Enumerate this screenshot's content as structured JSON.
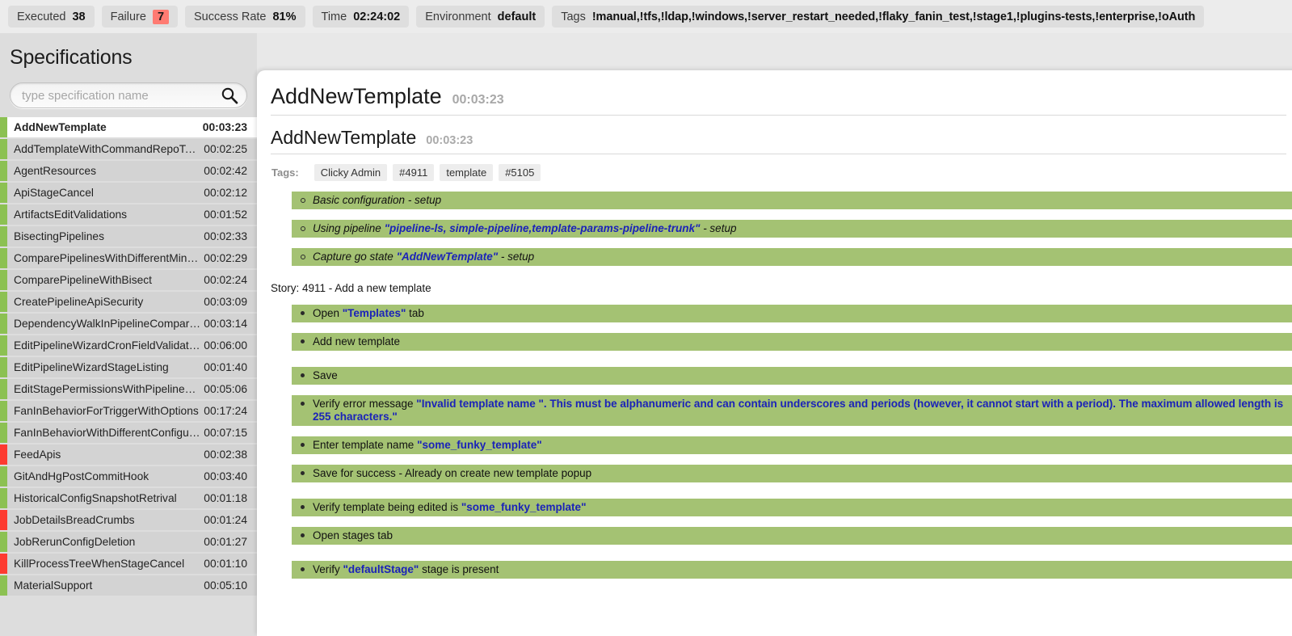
{
  "topbar": {
    "stats": [
      {
        "name": "executed",
        "label": "Executed",
        "value": "38",
        "fail": false
      },
      {
        "name": "failure",
        "label": "Failure",
        "value": "7",
        "fail": true
      },
      {
        "name": "success-rate",
        "label": "Success Rate",
        "value": "81%",
        "fail": false
      },
      {
        "name": "time",
        "label": "Time",
        "value": "02:24:02",
        "fail": false
      },
      {
        "name": "environment",
        "label": "Environment",
        "value": "default",
        "fail": false
      },
      {
        "name": "tags",
        "label": "Tags",
        "value": "!manual,!tfs,!ldap,!windows,!server_restart_needed,!flaky_fanin_test,!stage1,!plugins-tests,!enterprise,!oAuth",
        "fail": false
      }
    ]
  },
  "sidebar": {
    "title": "Specifications",
    "search_placeholder": "type specification name",
    "search_value": "",
    "items": [
      {
        "name": "AddNewTemplate",
        "time": "00:03:23",
        "status": "pass",
        "selected": true
      },
      {
        "name": "AddTemplateWithCommandRepoTask",
        "time": "00:02:25",
        "status": "pass",
        "selected": false
      },
      {
        "name": "AgentResources",
        "time": "00:02:42",
        "status": "pass",
        "selected": false
      },
      {
        "name": "ApiStageCancel",
        "time": "00:02:12",
        "status": "pass",
        "selected": false
      },
      {
        "name": "ArtifactsEditValidations",
        "time": "00:01:52",
        "status": "pass",
        "selected": false
      },
      {
        "name": "BisectingPipelines",
        "time": "00:02:33",
        "status": "pass",
        "selected": false
      },
      {
        "name": "ComparePipelinesWithDifferentMing…",
        "time": "00:02:29",
        "status": "pass",
        "selected": false
      },
      {
        "name": "ComparePipelineWithBisect",
        "time": "00:02:24",
        "status": "pass",
        "selected": false
      },
      {
        "name": "CreatePipelineApiSecurity",
        "time": "00:03:09",
        "status": "pass",
        "selected": false
      },
      {
        "name": "DependencyWalkInPipelineCompar…",
        "time": "00:03:14",
        "status": "pass",
        "selected": false
      },
      {
        "name": "EditPipelineWizardCronFieldValidati…",
        "time": "00:06:00",
        "status": "pass",
        "selected": false
      },
      {
        "name": "EditPipelineWizardStageListing",
        "time": "00:01:40",
        "status": "pass",
        "selected": false
      },
      {
        "name": "EditStagePermissionsWithPipelineG…",
        "time": "00:05:06",
        "status": "pass",
        "selected": false
      },
      {
        "name": "FanInBehaviorForTriggerWithOptions",
        "time": "00:17:24",
        "status": "pass",
        "selected": false
      },
      {
        "name": "FanInBehaviorWithDifferentConfigur…",
        "time": "00:07:15",
        "status": "pass",
        "selected": false
      },
      {
        "name": "FeedApis",
        "time": "00:02:38",
        "status": "fail",
        "selected": false
      },
      {
        "name": "GitAndHgPostCommitHook",
        "time": "00:03:40",
        "status": "pass",
        "selected": false
      },
      {
        "name": "HistoricalConfigSnapshotRetrival",
        "time": "00:01:18",
        "status": "pass",
        "selected": false
      },
      {
        "name": "JobDetailsBreadCrumbs",
        "time": "00:01:24",
        "status": "fail",
        "selected": false
      },
      {
        "name": "JobRerunConfigDeletion",
        "time": "00:01:27",
        "status": "pass",
        "selected": false
      },
      {
        "name": "KillProcessTreeWhenStageCancel",
        "time": "00:01:10",
        "status": "fail",
        "selected": false
      },
      {
        "name": "MaterialSupport",
        "time": "00:05:10",
        "status": "pass",
        "selected": false
      }
    ]
  },
  "content": {
    "spec_name": "AddNewTemplate",
    "spec_time": "00:03:23",
    "scenario_name": "AddNewTemplate",
    "scenario_time": "00:03:23",
    "tags_label": "Tags:",
    "tags": [
      "Clicky Admin",
      "#4911",
      "template",
      "#5105"
    ],
    "story_line": "Story: 4911 - Add a new template",
    "setup_steps": [
      {
        "pre": "Basic configuration - setup",
        "hl": "",
        "post": ""
      },
      {
        "pre": "Using pipeline ",
        "hl": "\"pipeline-ls, simple-pipeline,template-params-pipeline-trunk\"",
        "post": " - setup"
      },
      {
        "pre": "Capture go state ",
        "hl": "\"AddNewTemplate\"",
        "post": " - setup"
      }
    ],
    "steps": [
      {
        "pre": "Open ",
        "hl": "\"Templates\"",
        "post": " tab",
        "gap": false
      },
      {
        "pre": "Add new template",
        "hl": "",
        "post": "",
        "gap": true
      },
      {
        "pre": "Save",
        "hl": "",
        "post": "",
        "gap": false
      },
      {
        "pre": "Verify error message ",
        "hl": "\"Invalid template name \". This must be alphanumeric and can contain underscores and periods (however, it cannot start with a period). The maximum allowed length is 255 characters.\"",
        "post": "",
        "gap": false
      },
      {
        "pre": "Enter template name ",
        "hl": "\"some_funky_template\"",
        "post": "",
        "gap": false
      },
      {
        "pre": "Save for success - Already on create new template popup",
        "hl": "",
        "post": "",
        "gap": true
      },
      {
        "pre": "Verify template being edited is ",
        "hl": "\"some_funky_template\"",
        "post": "",
        "gap": false
      },
      {
        "pre": "Open stages tab",
        "hl": "",
        "post": "",
        "gap": true
      },
      {
        "pre": "Verify ",
        "hl": "\"defaultStage\"",
        "post": " stage is present",
        "gap": false
      }
    ]
  },
  "colors": {
    "pass": "#8cc152",
    "fail": "#fd3b30",
    "step_green": "#a4c273",
    "highlight_blue": "#1b23b8"
  }
}
